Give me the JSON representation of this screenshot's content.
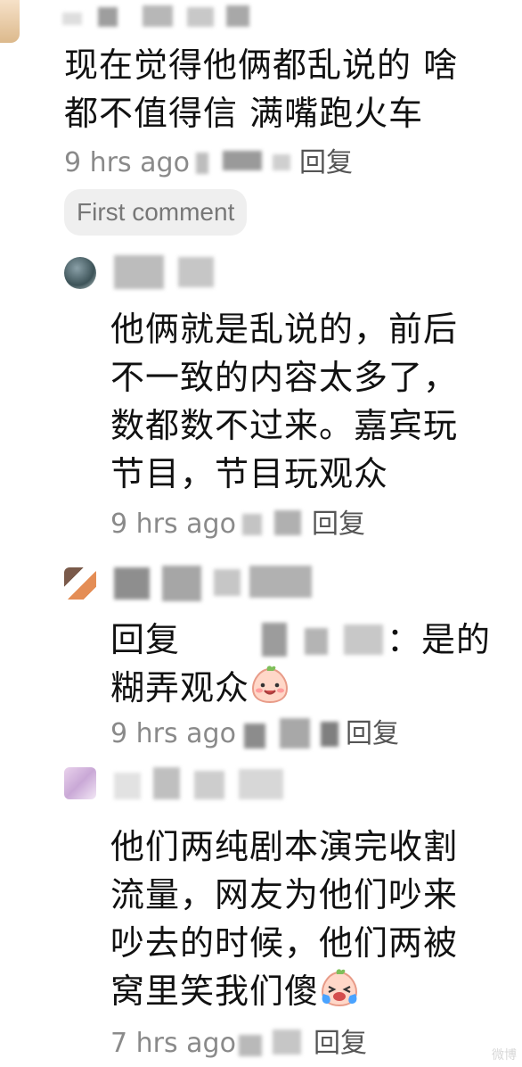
{
  "comments": [
    {
      "text_line1": "现在觉得他俩都乱说的 啥",
      "text_line2": "都不值得信 满嘴跑火车",
      "time": "9 hrs ago",
      "reply_label": "回复",
      "badge": "First comment"
    },
    {
      "text_lines": [
        "他俩就是乱说的，前后",
        "不一致的内容太多了，",
        "数都数不过来。嘉宾玩",
        "节目，节目玩观众"
      ],
      "time": "9 hrs ago",
      "reply_label": "回复"
    },
    {
      "reply_prefix": "回复",
      "reply_suffix": "：是的",
      "text_line2": "糊弄观众",
      "emoji": "smiling-peach-emoji",
      "time": "9 hrs ago",
      "reply_label": "回复"
    },
    {
      "text_lines": [
        "他们两纯剧本演完收割",
        "流量，网友为他们吵来",
        "吵去的时候，他们两被"
      ],
      "text_last": "窝里笑我们傻",
      "emoji": "laughing-crying-peach-emoji",
      "time": "7 hrs ago",
      "reply_label": "回复"
    }
  ],
  "watermark": "微博"
}
